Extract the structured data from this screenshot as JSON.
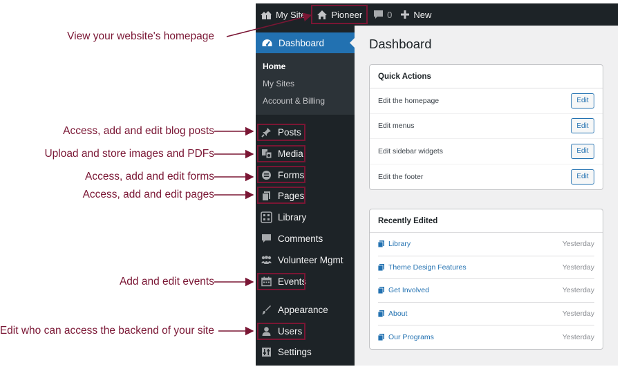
{
  "admin_bar": {
    "my_site": "My Site",
    "site_name": "Pioneer",
    "comments_count": "0",
    "new_label": "New"
  },
  "sidebar": {
    "dashboard": "Dashboard",
    "submenu": [
      "Home",
      "My Sites",
      "Account & Billing"
    ],
    "items": [
      {
        "label": "Posts",
        "icon": "pin-icon"
      },
      {
        "label": "Media",
        "icon": "media-icon"
      },
      {
        "label": "Forms",
        "icon": "forms-icon"
      },
      {
        "label": "Pages",
        "icon": "pages-icon"
      },
      {
        "label": "Library",
        "icon": "grid-icon"
      },
      {
        "label": "Comments",
        "icon": "comment-icon"
      },
      {
        "label": "Volunteer Mgmt",
        "icon": "people-icon"
      },
      {
        "label": "Events",
        "icon": "calendar-icon"
      },
      {
        "label": "Appearance",
        "icon": "brush-icon"
      },
      {
        "label": "Users",
        "icon": "user-icon"
      },
      {
        "label": "Settings",
        "icon": "settings-icon"
      }
    ]
  },
  "main": {
    "title": "Dashboard",
    "quick_actions": {
      "title": "Quick Actions",
      "button_label": "Edit",
      "rows": [
        "Edit the homepage",
        "Edit menus",
        "Edit sidebar widgets",
        "Edit the footer"
      ]
    },
    "recently_edited": {
      "title": "Recently Edited",
      "rows": [
        {
          "name": "Library",
          "date": "Yesterday"
        },
        {
          "name": "Theme Design Features",
          "date": "Yesterday"
        },
        {
          "name": "Get Involved",
          "date": "Yesterday"
        },
        {
          "name": "About",
          "date": "Yesterday"
        },
        {
          "name": "Our Programs",
          "date": "Yesterday"
        }
      ]
    }
  },
  "annotations": {
    "homepage": "View your website's homepage",
    "posts": "Access, add and edit blog posts",
    "media": "Upload and store images and PDFs",
    "forms": "Access, add and edit forms",
    "pages": "Access, add and edit pages",
    "events": "Add and edit events",
    "users": "Edit who can access the backend of your site"
  },
  "colors": {
    "annotation": "#7a1634",
    "admin_dark": "#1d2327",
    "accent": "#2271b1",
    "content_bg": "#f0f0f1"
  }
}
